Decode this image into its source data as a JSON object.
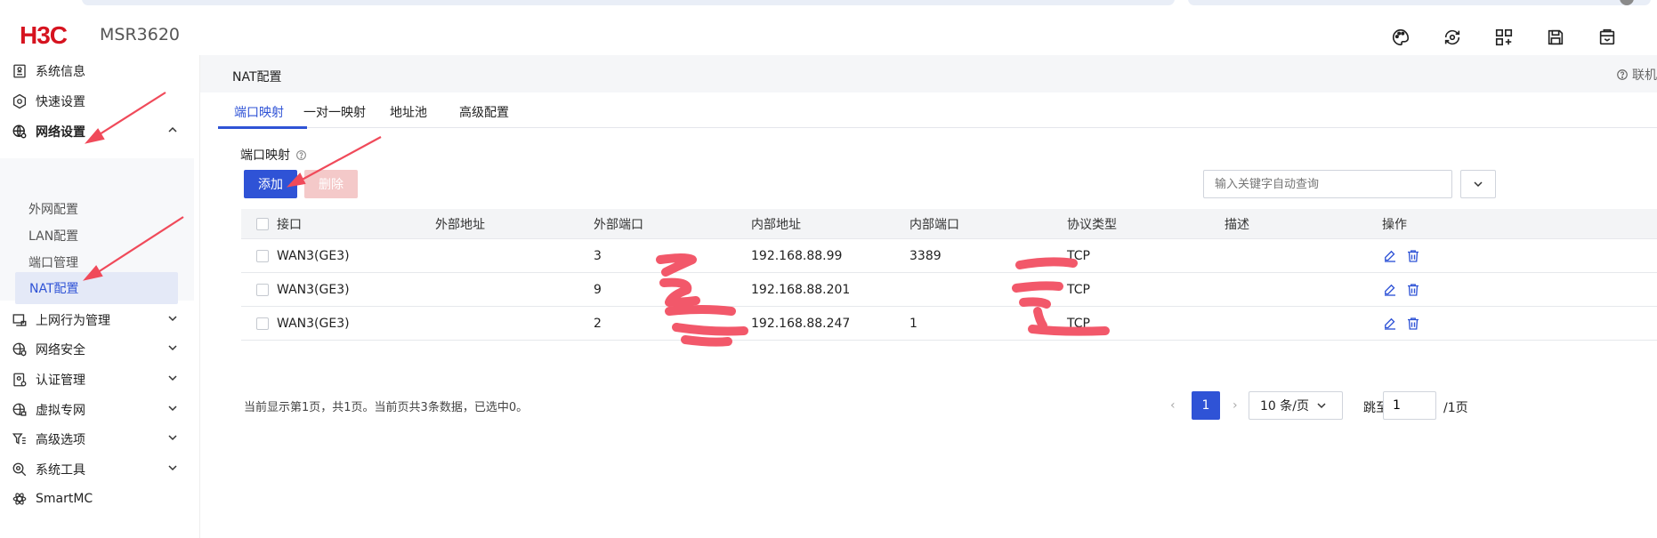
{
  "header": {
    "logo": "H3C",
    "model": "MSR3620"
  },
  "sidebar": {
    "items": [
      {
        "label": "系统信息"
      },
      {
        "label": "快速设置"
      },
      {
        "label": "网络设置"
      },
      {
        "label": "上网行为管理"
      },
      {
        "label": "网络安全"
      },
      {
        "label": "认证管理"
      },
      {
        "label": "虚拟专网"
      },
      {
        "label": "高级选项"
      },
      {
        "label": "系统工具"
      },
      {
        "label": "SmartMC"
      }
    ],
    "network_sub": [
      {
        "label": "外网配置"
      },
      {
        "label": "LAN配置"
      },
      {
        "label": "端口管理"
      },
      {
        "label": "NAT配置"
      }
    ]
  },
  "main": {
    "breadcrumb": "NAT配置",
    "online_label": "联机",
    "tabs": [
      {
        "label": "端口映射"
      },
      {
        "label": "一对一映射"
      },
      {
        "label": "地址池"
      },
      {
        "label": "高级配置"
      }
    ],
    "section_title": "端口映射",
    "add_label": "添加",
    "delete_label": "删除",
    "search_placeholder": "输入关键字自动查询"
  },
  "table": {
    "headers": [
      "接口",
      "外部地址",
      "外部端口",
      "内部地址",
      "内部端口",
      "协议类型",
      "描述",
      "操作"
    ],
    "rows": [
      {
        "iface": "WAN3(GE3)",
        "ext_addr": "",
        "ext_port": "3",
        "int_addr": "192.168.88.99",
        "int_port": "3389",
        "proto": "TCP",
        "desc": ""
      },
      {
        "iface": "WAN3(GE3)",
        "ext_addr": "",
        "ext_port": "9",
        "int_addr": "192.168.88.201",
        "int_port": "",
        "proto": "TCP",
        "desc": ""
      },
      {
        "iface": "WAN3(GE3)",
        "ext_addr": "",
        "ext_port": "2",
        "int_addr": "192.168.88.247",
        "int_port": "1",
        "proto": "TCP",
        "desc": ""
      }
    ]
  },
  "footer": {
    "info": "当前显示第1页，共1页。当前页共3条数据，已选中0。",
    "current_page": "1",
    "page_size": "10 条/页",
    "jump_label": "跳至",
    "jump_value": "1",
    "total_label": "/1页"
  },
  "colors": {
    "brand_red": "#d6131f",
    "primary_blue": "#2f53d6",
    "annotation_red": "#f04a5a",
    "redaction_pink": "#f2586a"
  }
}
